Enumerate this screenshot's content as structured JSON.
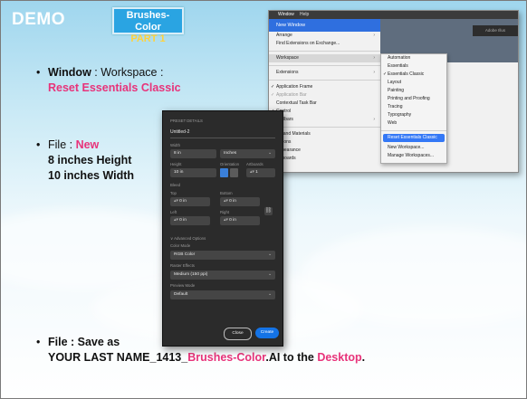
{
  "slide": {
    "heading": "DEMO",
    "badge": {
      "line1": "Brushes-Color",
      "line2": "PART 1"
    },
    "bullets": {
      "window_bold": "Window",
      "window_rest": " : Workspace :",
      "window_action": "Reset Essentials Classic",
      "file_prefix": "File : ",
      "file_new": "New",
      "height": "8 inches Height",
      "width": "10 inches Width",
      "save": "File : Save as",
      "save_name": "YOUR LAST NAME_1413_",
      "save_highlight": "Brushes-Color",
      "save_mid": ".AI to the ",
      "save_dest": "Desktop",
      "save_end": "."
    }
  },
  "window_menu": {
    "menubar": [
      "Window",
      "Help"
    ],
    "top_item": "New Window",
    "items": [
      {
        "label": "Arrange",
        "arrow": true
      },
      {
        "label": "Find Extensions on Exchange..."
      },
      {
        "label": "Workspace",
        "arrow": true,
        "highlight": true
      },
      {
        "label": "Extensions",
        "arrow": true
      },
      {
        "label": "Application Frame",
        "check": true
      },
      {
        "label": "Application Bar",
        "check": true,
        "dim": true
      },
      {
        "label": "Contextual Task Bar"
      },
      {
        "label": "Control",
        "check": true
      },
      {
        "label": "Toolbars",
        "arrow": true
      },
      {
        "label": "3D and Materials"
      },
      {
        "label": "Actions"
      },
      {
        "label": "Appearance"
      },
      {
        "label": "Artboards"
      }
    ],
    "bg_label": "Adobe Illus",
    "workspace_submenu": [
      {
        "label": "Automation"
      },
      {
        "label": "Essentials"
      },
      {
        "label": "Essentials Classic",
        "check": true
      },
      {
        "label": "Layout"
      },
      {
        "label": "Painting"
      },
      {
        "label": "Printing and Proofing"
      },
      {
        "label": "Tracing"
      },
      {
        "label": "Typography"
      },
      {
        "label": "Web"
      },
      {
        "label": "Reset Essentials Classic",
        "selected": true
      },
      {
        "label": "New Workspace..."
      },
      {
        "label": "Manage Workspaces..."
      }
    ]
  },
  "new_doc_dialog": {
    "section_title": "PRESET DETAILS",
    "name": "Untitled-2",
    "width_label": "Width",
    "width_value": "8 in",
    "unit": "Inches",
    "height_label": "Height",
    "height_value": "10 in",
    "orientation_label": "Orientation",
    "artboards_label": "Artboards",
    "artboards_value": "1",
    "bleed_label": "Bleed",
    "top_label": "Top",
    "bottom_label": "Bottom",
    "left_label": "Left",
    "right_label": "Right",
    "bleed_value": "0 in",
    "advanced_label": "Advanced Options",
    "color_mode_label": "Color Mode",
    "color_mode_value": "RGB Color",
    "raster_label": "Raster Effects",
    "raster_value": "Medium (150 ppi)",
    "preview_label": "Preview Mode",
    "preview_value": "Default",
    "close_label": "Close",
    "create_label": "Create"
  },
  "colors": {
    "accent_pink": "#e8337a",
    "badge_blue": "#2aa4e2",
    "create_blue": "#1473e6"
  }
}
